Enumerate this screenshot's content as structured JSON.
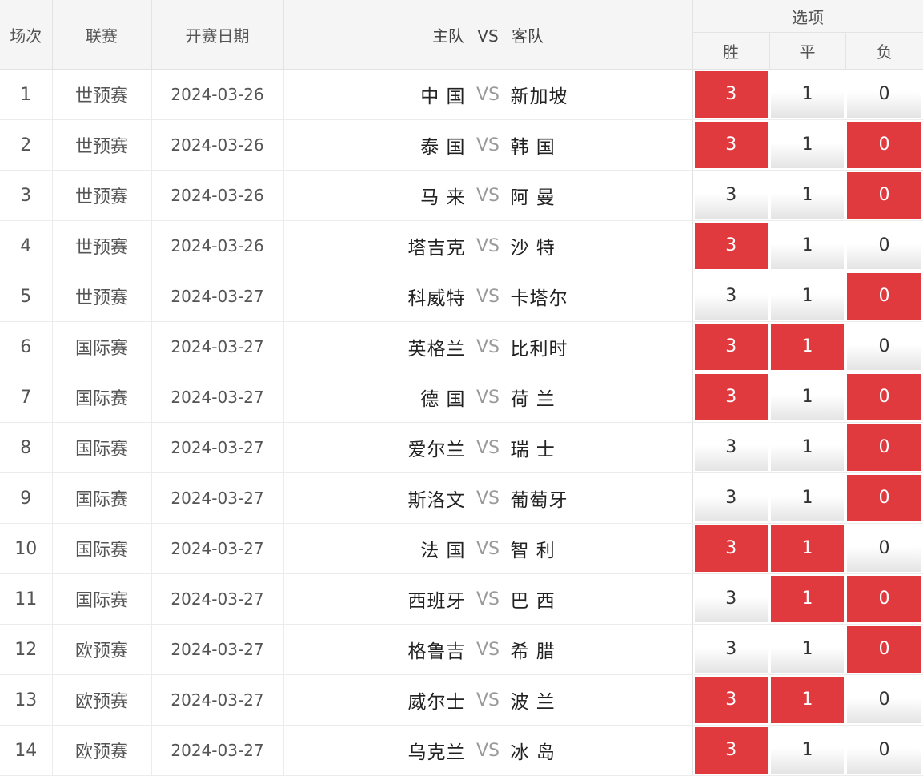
{
  "header": {
    "num": "场次",
    "league": "联赛",
    "date": "开赛日期",
    "home": "主队",
    "vs": "VS",
    "away": "客队",
    "options": "选项",
    "win": "胜",
    "draw": "平",
    "lose": "负"
  },
  "colors": {
    "selected": "#e0393e",
    "header_bg": "#f5f5f5"
  },
  "rows": [
    {
      "num": "1",
      "league": "世预赛",
      "date": "2024-03-26",
      "home": "中 国",
      "vs": "VS",
      "away": "新加坡",
      "win": "3",
      "draw": "1",
      "lose": "0",
      "win_sel": true,
      "draw_sel": false,
      "lose_sel": false
    },
    {
      "num": "2",
      "league": "世预赛",
      "date": "2024-03-26",
      "home": "泰 国",
      "vs": "VS",
      "away": "韩 国",
      "win": "3",
      "draw": "1",
      "lose": "0",
      "win_sel": true,
      "draw_sel": false,
      "lose_sel": true
    },
    {
      "num": "3",
      "league": "世预赛",
      "date": "2024-03-26",
      "home": "马 来",
      "vs": "VS",
      "away": "阿 曼",
      "win": "3",
      "draw": "1",
      "lose": "0",
      "win_sel": false,
      "draw_sel": false,
      "lose_sel": true
    },
    {
      "num": "4",
      "league": "世预赛",
      "date": "2024-03-26",
      "home": "塔吉克",
      "vs": "VS",
      "away": "沙 特",
      "win": "3",
      "draw": "1",
      "lose": "0",
      "win_sel": true,
      "draw_sel": false,
      "lose_sel": false
    },
    {
      "num": "5",
      "league": "世预赛",
      "date": "2024-03-27",
      "home": "科威特",
      "vs": "VS",
      "away": "卡塔尔",
      "win": "3",
      "draw": "1",
      "lose": "0",
      "win_sel": false,
      "draw_sel": false,
      "lose_sel": true
    },
    {
      "num": "6",
      "league": "国际赛",
      "date": "2024-03-27",
      "home": "英格兰",
      "vs": "VS",
      "away": "比利时",
      "win": "3",
      "draw": "1",
      "lose": "0",
      "win_sel": true,
      "draw_sel": true,
      "lose_sel": false
    },
    {
      "num": "7",
      "league": "国际赛",
      "date": "2024-03-27",
      "home": "德 国",
      "vs": "VS",
      "away": "荷 兰",
      "win": "3",
      "draw": "1",
      "lose": "0",
      "win_sel": true,
      "draw_sel": false,
      "lose_sel": true
    },
    {
      "num": "8",
      "league": "国际赛",
      "date": "2024-03-27",
      "home": "爱尔兰",
      "vs": "VS",
      "away": "瑞 士",
      "win": "3",
      "draw": "1",
      "lose": "0",
      "win_sel": false,
      "draw_sel": false,
      "lose_sel": true
    },
    {
      "num": "9",
      "league": "国际赛",
      "date": "2024-03-27",
      "home": "斯洛文",
      "vs": "VS",
      "away": "葡萄牙",
      "win": "3",
      "draw": "1",
      "lose": "0",
      "win_sel": false,
      "draw_sel": false,
      "lose_sel": true
    },
    {
      "num": "10",
      "league": "国际赛",
      "date": "2024-03-27",
      "home": "法 国",
      "vs": "VS",
      "away": "智 利",
      "win": "3",
      "draw": "1",
      "lose": "0",
      "win_sel": true,
      "draw_sel": true,
      "lose_sel": false
    },
    {
      "num": "11",
      "league": "国际赛",
      "date": "2024-03-27",
      "home": "西班牙",
      "vs": "VS",
      "away": "巴 西",
      "win": "3",
      "draw": "1",
      "lose": "0",
      "win_sel": false,
      "draw_sel": true,
      "lose_sel": true
    },
    {
      "num": "12",
      "league": "欧预赛",
      "date": "2024-03-27",
      "home": "格鲁吉",
      "vs": "VS",
      "away": "希 腊",
      "win": "3",
      "draw": "1",
      "lose": "0",
      "win_sel": false,
      "draw_sel": false,
      "lose_sel": true
    },
    {
      "num": "13",
      "league": "欧预赛",
      "date": "2024-03-27",
      "home": "威尔士",
      "vs": "VS",
      "away": "波 兰",
      "win": "3",
      "draw": "1",
      "lose": "0",
      "win_sel": true,
      "draw_sel": true,
      "lose_sel": false
    },
    {
      "num": "14",
      "league": "欧预赛",
      "date": "2024-03-27",
      "home": "乌克兰",
      "vs": "VS",
      "away": "冰 岛",
      "win": "3",
      "draw": "1",
      "lose": "0",
      "win_sel": true,
      "draw_sel": false,
      "lose_sel": false
    }
  ]
}
